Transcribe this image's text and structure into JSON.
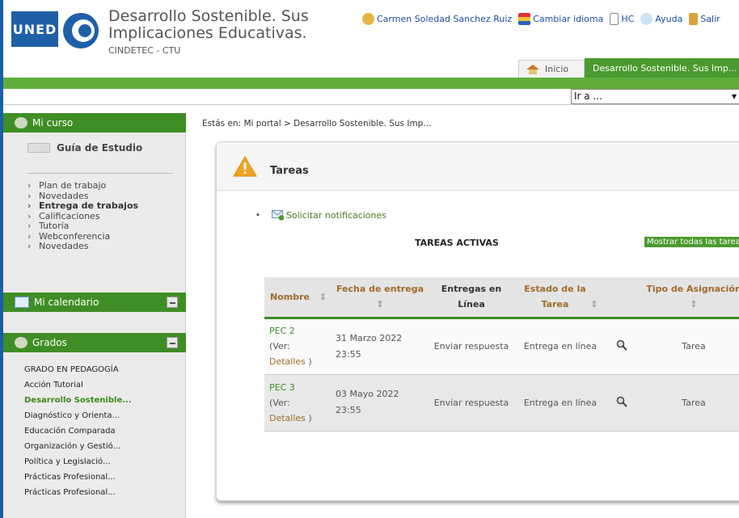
{
  "header": {
    "logo_text": "UNED",
    "title": "Desarrollo Sostenible. Sus Implicaciones Educativas.",
    "subtitle": "CINDETEC - CTU",
    "user_name": "Carmen Soledad Sanchez Ruiz",
    "change_language": "Cambiar idioma",
    "hc": "HC",
    "help": "Ayuda",
    "logout": "Salir",
    "tab_home": "Inicio",
    "tab_course": "Desarrollo Sostenible. Sus Imp...",
    "goto": "Ir a ..."
  },
  "sidebar": {
    "mi_curso": "Mi curso",
    "guia": "Guía de Estudio",
    "items": [
      {
        "label": "Plan de trabajo"
      },
      {
        "label": "Novedades"
      },
      {
        "label": "Entrega de trabajos"
      },
      {
        "label": "Calificaciones"
      },
      {
        "label": "Tutoría"
      },
      {
        "label": "Webconferencia"
      },
      {
        "label": "Novedades"
      }
    ],
    "mi_calendario": "Mi calendario",
    "grados": "Grados",
    "grados_items": [
      {
        "label": "GRADO EN PEDAGOGÍA"
      },
      {
        "label": "Acción Tutorial"
      },
      {
        "label": "Desarrollo Sostenible..."
      },
      {
        "label": "Diagnóstico y Orienta..."
      },
      {
        "label": "Educación Comparada"
      },
      {
        "label": "Organización y Gestió..."
      },
      {
        "label": "Política y Legislació..."
      },
      {
        "label": "Prácticas Profesional..."
      },
      {
        "label": "Prácticas Profesional..."
      }
    ]
  },
  "main": {
    "breadcrumb": "Estás en: Mi portal > Desarrollo Sostenible. Sus Imp...",
    "card_title": "Tareas",
    "notifications": "Solicitar notificaciones",
    "active_title": "TAREAS ACTIVAS",
    "show_all": "Mostrar todas las tareas",
    "columns": {
      "nombre": "Nombre",
      "fecha": "Fecha de entrega",
      "entregas": "Entregas en Línea",
      "estado": "Estado de la Tarea",
      "tipo": "Tipo de Asignación",
      "sort": "⇕"
    },
    "rows": [
      {
        "name": "PEC 2",
        "ver": "(Ver:",
        "detalles": "Detalles",
        "close": ")",
        "date": "31 Marzo 2022",
        "time": "23:55",
        "action": "Enviar respuesta",
        "state": "Entrega en línea",
        "tipo": "Tarea"
      },
      {
        "name": "PEC 3",
        "ver": "(Ver:",
        "detalles": "Detalles",
        "close": ")",
        "date": "03 Mayo 2022",
        "time": "23:55",
        "action": "Enviar respuesta",
        "state": "Entrega en línea",
        "tipo": "Tarea"
      }
    ]
  }
}
